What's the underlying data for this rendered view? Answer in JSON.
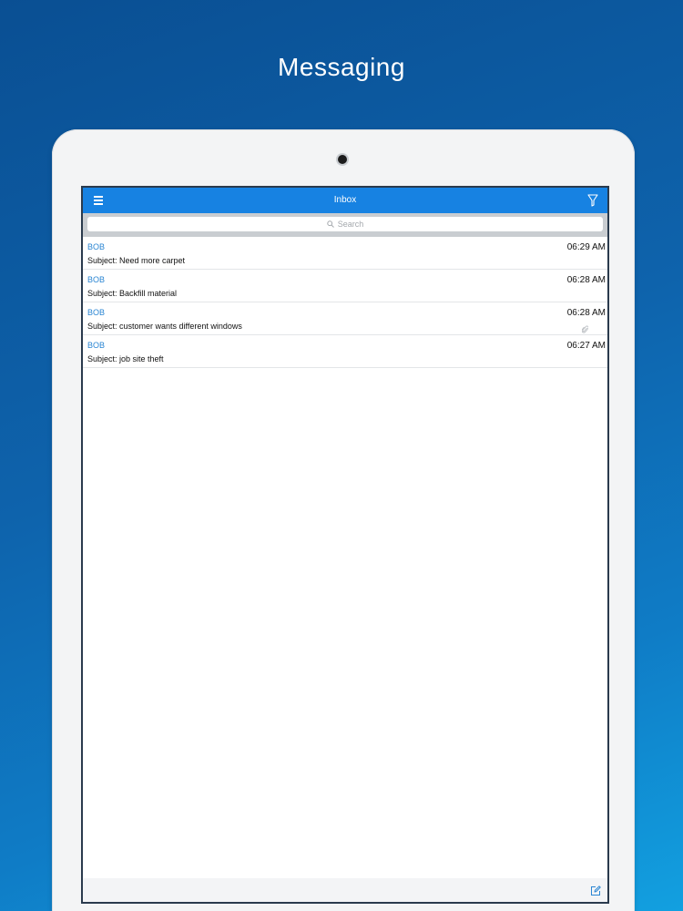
{
  "promo": {
    "title": "Messaging"
  },
  "navbar": {
    "title": "Inbox",
    "menu_icon": "hamburger-menu-icon",
    "filter_icon": "filter-funnel-icon"
  },
  "search": {
    "placeholder": "Search",
    "icon": "search-icon"
  },
  "messages": [
    {
      "sender": "BOB",
      "subject": "Subject: Need more carpet",
      "time": "06:29 AM",
      "has_attachment": false
    },
    {
      "sender": "BOB",
      "subject": "Subject: Backfill material",
      "time": "06:28 AM",
      "has_attachment": false
    },
    {
      "sender": "BOB",
      "subject": "Subject: customer wants different windows",
      "time": "06:28 AM",
      "has_attachment": true
    },
    {
      "sender": "BOB",
      "subject": "Subject: job site theft",
      "time": "06:27 AM",
      "has_attachment": false
    }
  ],
  "toolbar": {
    "compose_icon": "compose-icon"
  },
  "colors": {
    "navbar": "#1782e2",
    "sender": "#2b86d3",
    "background_top": "#0a4f93",
    "background_bottom": "#12a0e0"
  }
}
